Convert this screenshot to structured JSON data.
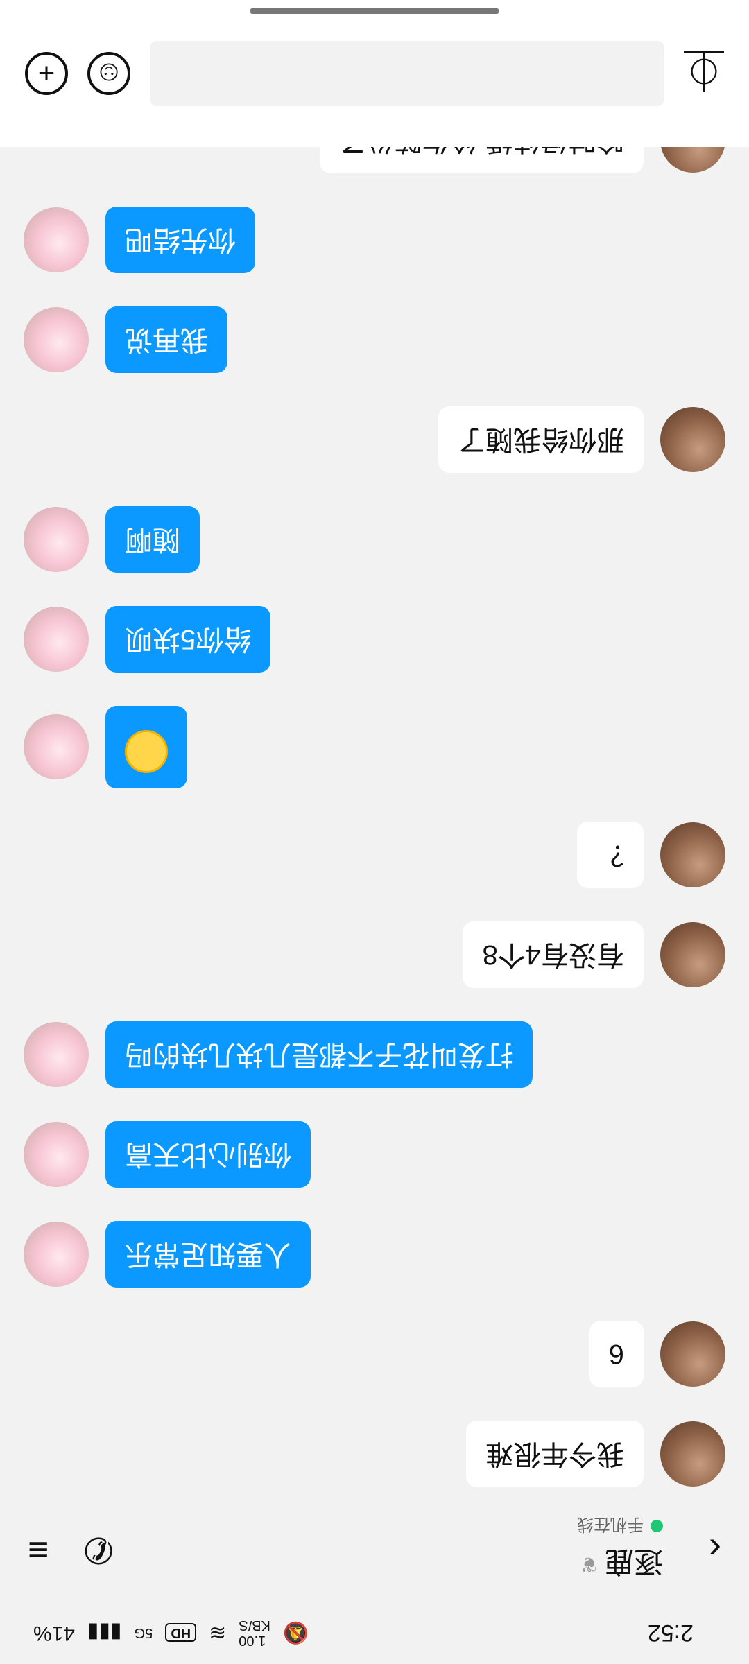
{
  "status": {
    "time": "2:52",
    "speed_value": "1.00",
    "speed_unit": "KB/S",
    "hd": "HD",
    "network": "5G",
    "battery": "41%"
  },
  "header": {
    "title": "逐鹿",
    "online_text": "手机在线"
  },
  "messages": [
    {
      "from": "friend",
      "text": "我今年很难"
    },
    {
      "from": "friend",
      "text": "6"
    },
    {
      "from": "me",
      "text": "人要知足常乐"
    },
    {
      "from": "me",
      "text": "你别心比天高"
    },
    {
      "from": "me",
      "text": "打发叫花子不都是几块几块的吗"
    },
    {
      "from": "friend",
      "text": "有没有4个8"
    },
    {
      "from": "friend",
      "text": "？"
    },
    {
      "from": "me",
      "emoji": "smile-emoji"
    },
    {
      "from": "me",
      "text": "给你5块呗"
    },
    {
      "from": "me",
      "text": "随啊"
    },
    {
      "from": "friend",
      "text": "那你给我随了"
    },
    {
      "from": "me",
      "text": "我再说"
    },
    {
      "from": "me",
      "text": "你先结吧"
    },
    {
      "from": "friend",
      "text": "啥时候结婚 给你随份子"
    }
  ],
  "input": {
    "value": "",
    "placeholder": ""
  },
  "icons": {
    "back": "chevron-left-icon",
    "phone": "phone-icon",
    "menu": "menu-icon",
    "voice": "voice-icon",
    "emoji": "emoji-icon",
    "add": "add-icon",
    "scroll_top": "chevron-up-icon"
  },
  "colors": {
    "my_bubble": "#0b99ff",
    "friend_bubble": "#ffffff",
    "online_dot": "#1ec773"
  }
}
